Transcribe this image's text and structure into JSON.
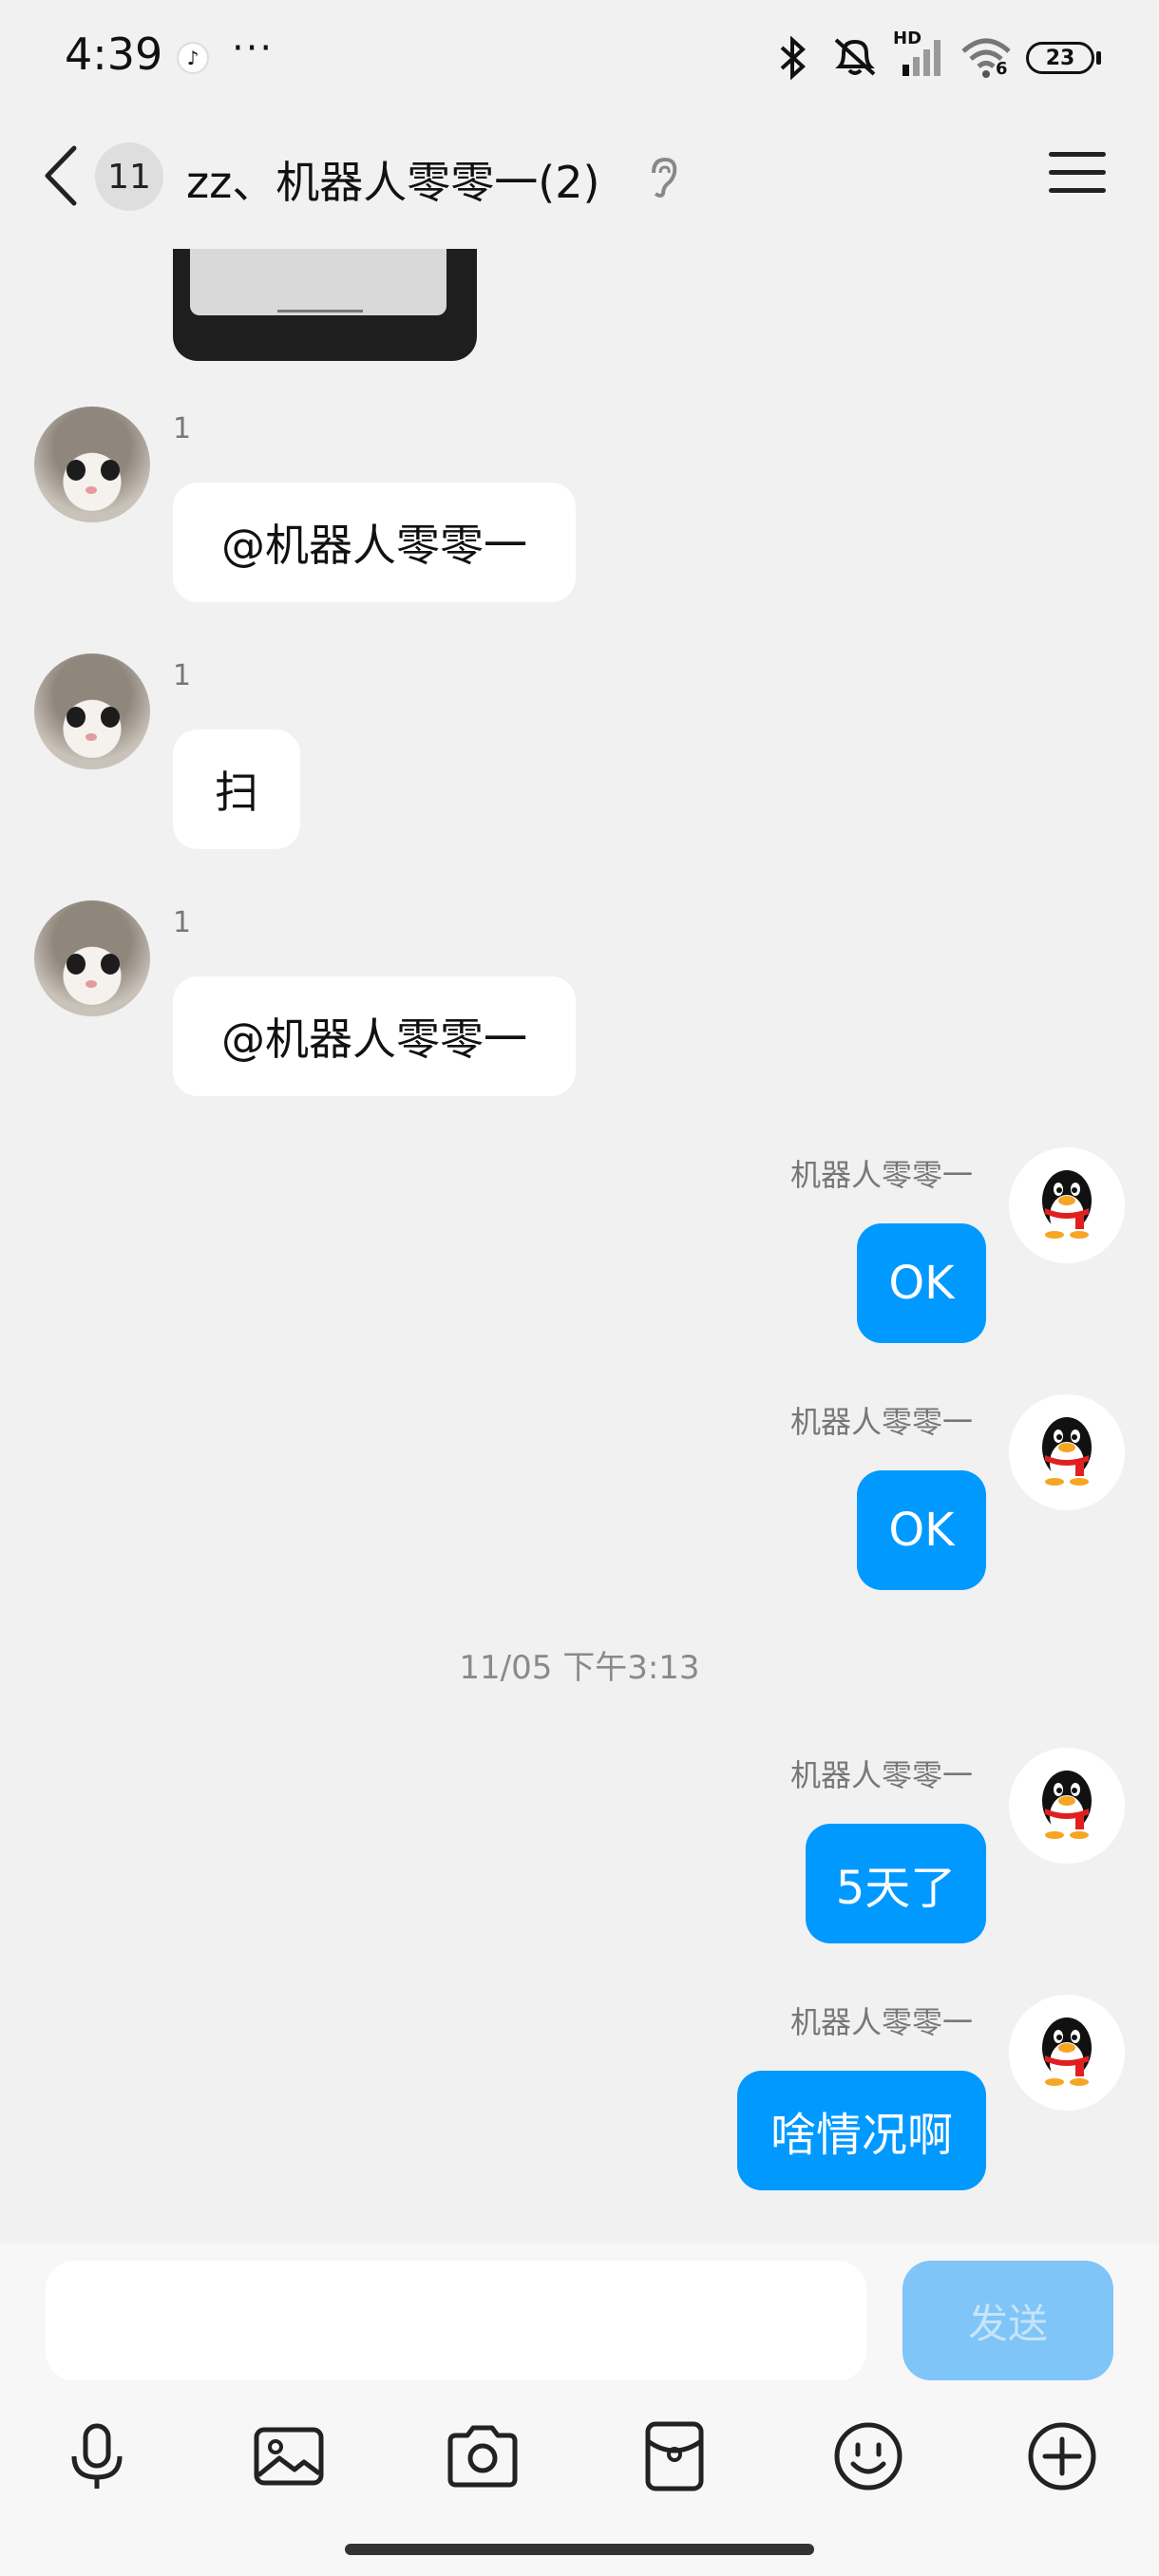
{
  "status_bar": {
    "time": "4:39",
    "more_indicator": "···",
    "battery_level": "23",
    "network_label": "HD",
    "wifi_label": "6"
  },
  "header": {
    "unread_count": "11",
    "title": "zz、机器人零零一(2)"
  },
  "messages": [
    {
      "type": "image",
      "direction": "incoming"
    },
    {
      "direction": "incoming",
      "sender": "1",
      "text": "@机器人零零一"
    },
    {
      "direction": "incoming",
      "sender": "1",
      "text": "扫"
    },
    {
      "direction": "incoming",
      "sender": "1",
      "text": "@机器人零零一"
    },
    {
      "direction": "outgoing",
      "sender": "机器人零零一",
      "text": "OK"
    },
    {
      "direction": "outgoing",
      "sender": "机器人零零一",
      "text": "OK"
    },
    {
      "type": "timestamp",
      "text": "11/05 下午3:13"
    },
    {
      "direction": "outgoing",
      "sender": "机器人零零一",
      "text": "5天了"
    },
    {
      "direction": "outgoing",
      "sender": "机器人零零一",
      "text": "啥情况啊"
    }
  ],
  "input": {
    "value": "",
    "send_label": "发送"
  },
  "toolbar": {
    "icons": [
      "microphone-icon",
      "image-icon",
      "camera-icon",
      "red-packet-icon",
      "emoji-icon",
      "plus-icon"
    ]
  },
  "colors": {
    "outgoing_bubble": "#0099ff",
    "send_button_disabled": "#7fc5f7",
    "background": "#f1f1f1"
  }
}
